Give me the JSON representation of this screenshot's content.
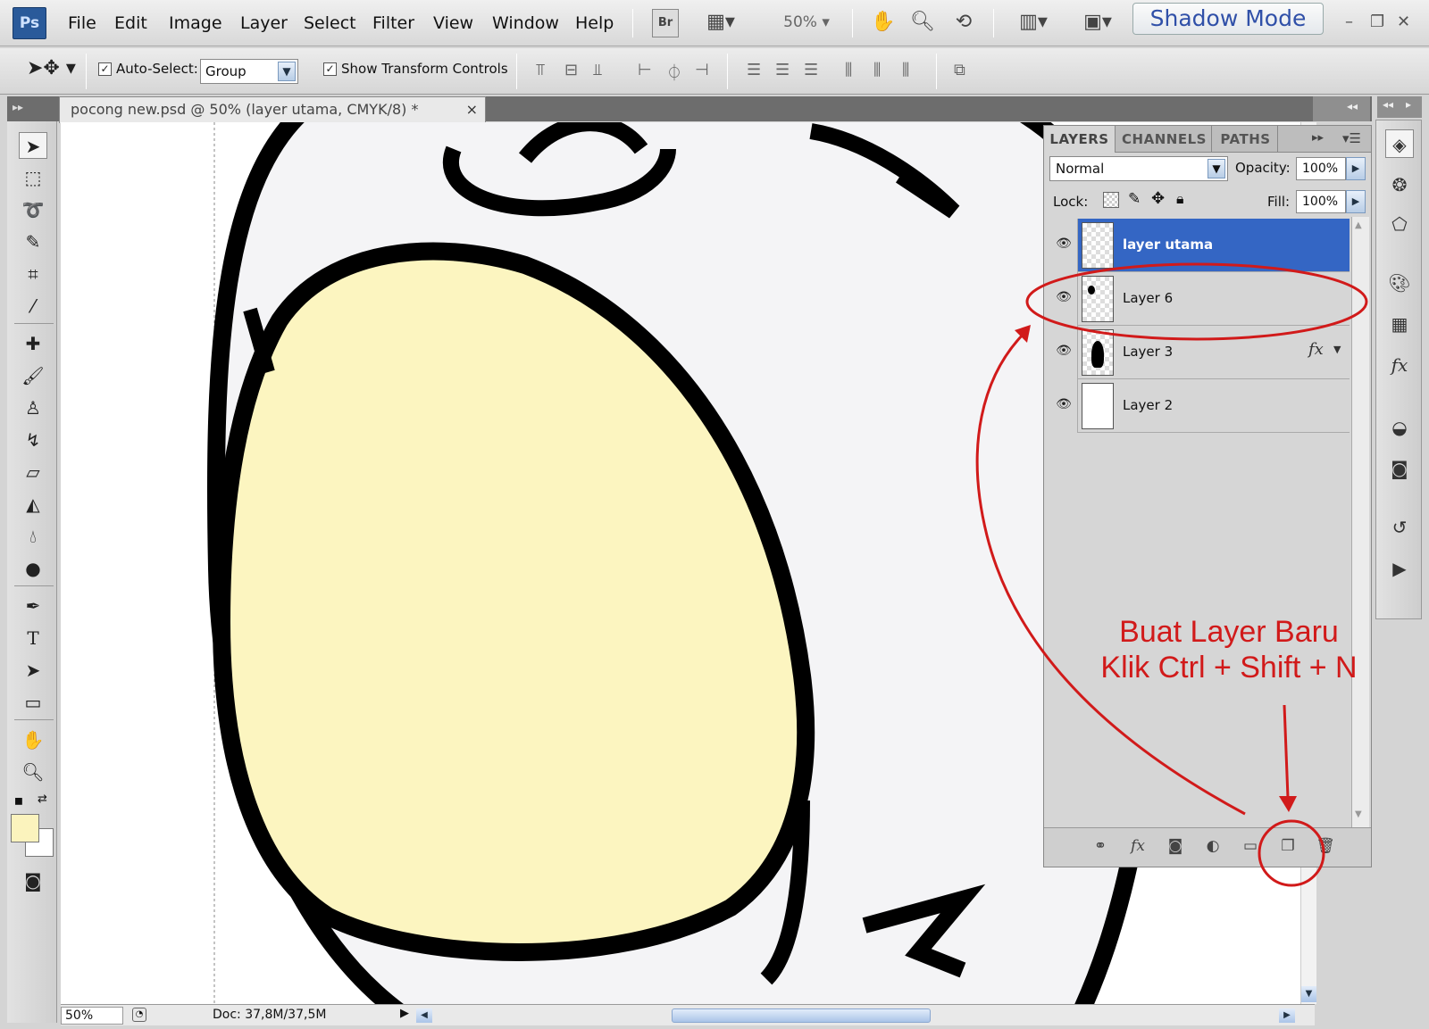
{
  "app": {
    "logo": "Ps",
    "shadow_mode": "Shadow Mode",
    "zoom_menu": "50%",
    "br_label": "Br"
  },
  "menu": [
    "File",
    "Edit",
    "Image",
    "Layer",
    "Select",
    "Filter",
    "View",
    "Window",
    "Help"
  ],
  "options": {
    "auto_select_label": "Auto-Select:",
    "auto_select_checked": true,
    "auto_select_value": "Group",
    "show_transform_label": "Show Transform Controls",
    "show_transform_checked": true
  },
  "document": {
    "tab_title": "pocong new.psd @ 50% (layer utama, CMYK/8) *",
    "close": "×"
  },
  "status": {
    "zoom": "50%",
    "doc_info": "Doc: 37,8M/37,5M"
  },
  "colors": {
    "foreground": "#fbf3bd",
    "background": "#ffffff",
    "selection": "#3466c4",
    "annotation": "#d11a1a",
    "fill_shape": "#fcf5c0"
  },
  "layers_panel": {
    "tabs": [
      "LAYERS",
      "CHANNELS",
      "PATHS"
    ],
    "blend_mode": "Normal",
    "opacity_label": "Opacity:",
    "opacity": "100%",
    "lock_label": "Lock:",
    "fill_label": "Fill:",
    "fill": "100%",
    "layers": [
      {
        "name": "layer utama",
        "selected": true,
        "visible": true,
        "fx": ""
      },
      {
        "name": "Layer 6",
        "selected": false,
        "visible": true,
        "fx": ""
      },
      {
        "name": "Layer 3",
        "selected": false,
        "visible": true,
        "fx": "fx"
      },
      {
        "name": "Layer 2",
        "selected": false,
        "visible": true,
        "fx": ""
      }
    ]
  },
  "annotation": {
    "line1": "Buat Layer Baru",
    "line2": "Klik Ctrl + Shift + N"
  }
}
